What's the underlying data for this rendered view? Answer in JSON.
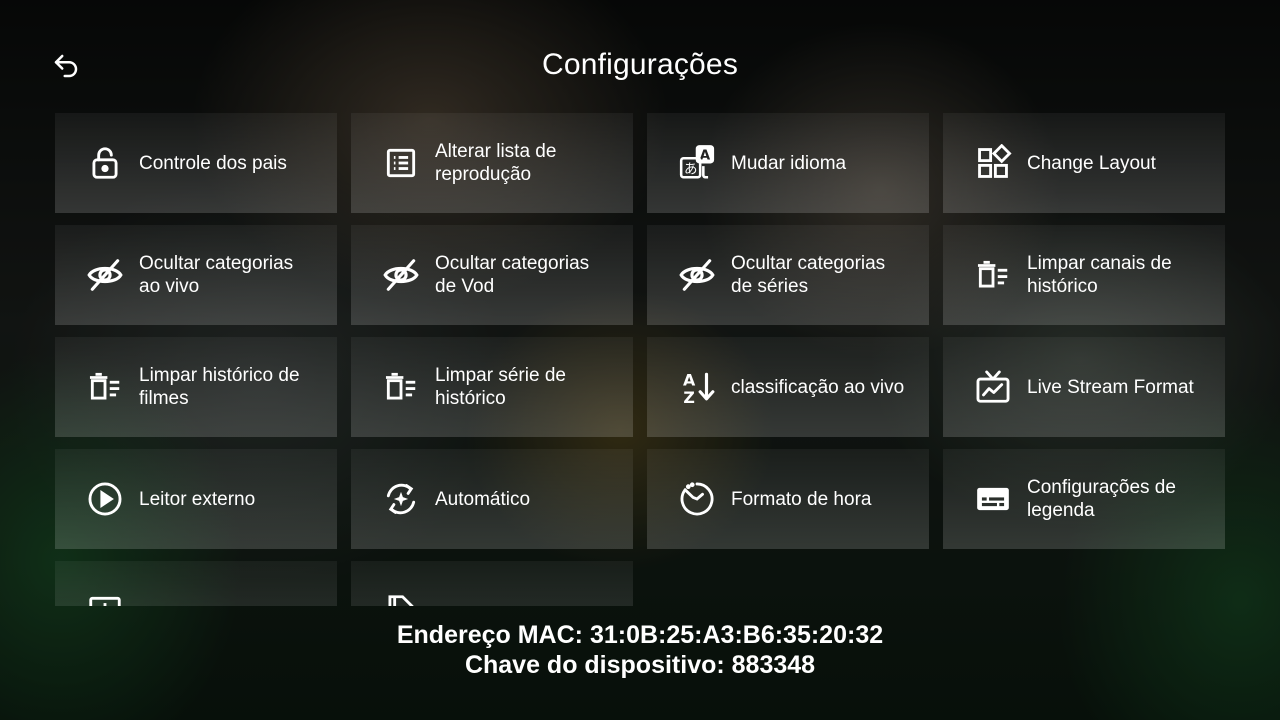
{
  "header": {
    "title": "Configurações"
  },
  "settings": {
    "items": [
      {
        "label": "Controle dos pais",
        "icon": "lock-open-icon"
      },
      {
        "label": "Alterar lista de reprodução",
        "icon": "playlist-icon"
      },
      {
        "label": "Mudar idioma",
        "icon": "translate-icon"
      },
      {
        "label": "Change Layout",
        "icon": "layout-icon"
      },
      {
        "label": "Ocultar categorias ao vivo",
        "icon": "eye-off-icon"
      },
      {
        "label": "Ocultar categorias de Vod",
        "icon": "eye-off-icon"
      },
      {
        "label": "Ocultar categorias de séries",
        "icon": "eye-off-icon"
      },
      {
        "label": "Limpar canais de histórico",
        "icon": "trash-list-icon"
      },
      {
        "label": "Limpar histórico de filmes",
        "icon": "trash-list-icon"
      },
      {
        "label": "Limpar série de histórico",
        "icon": "trash-list-icon"
      },
      {
        "label": "classificação ao vivo",
        "icon": "sort-az-icon"
      },
      {
        "label": "Live Stream Format",
        "icon": "tv-icon"
      },
      {
        "label": "Leitor externo",
        "icon": "play-circle-icon"
      },
      {
        "label": "Automático",
        "icon": "auto-refresh-icon"
      },
      {
        "label": "Formato de hora",
        "icon": "clock-icon"
      },
      {
        "label": "Configurações de legenda",
        "icon": "subtitles-icon"
      },
      {
        "label": "",
        "icon": "screen-icon"
      },
      {
        "label": "",
        "icon": "file-icon"
      }
    ]
  },
  "footer": {
    "mac_address": "Endereço MAC: 31:0B:25:A3:B6:35:20:32",
    "device_key": "Chave do dispositivo: 883348"
  },
  "colors": {
    "tile_text": "#ffffff",
    "accent_green": "#1e6e32"
  }
}
